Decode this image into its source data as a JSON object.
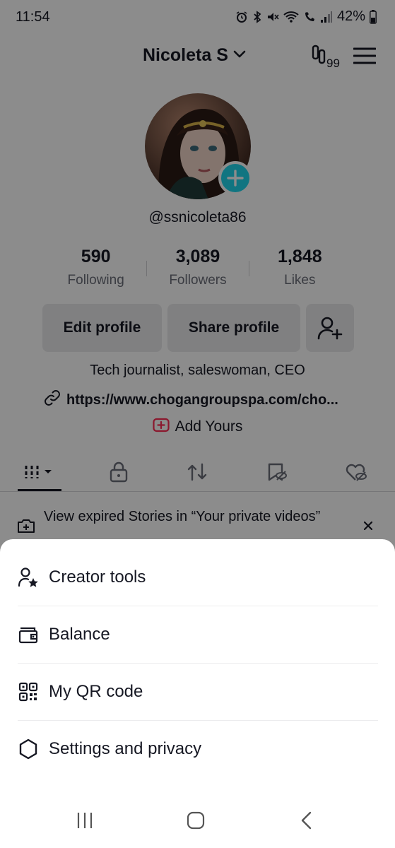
{
  "status_bar": {
    "time": "11:54",
    "battery": "42%",
    "icons": [
      "alarm-icon",
      "bluetooth-icon",
      "mute-icon",
      "wifi-icon",
      "wifi-calling-icon",
      "signal-icon",
      "battery-icon"
    ]
  },
  "header": {
    "display_name": "Nicoleta S",
    "badge_count": "99"
  },
  "profile": {
    "handle": "@ssnicoleta86",
    "stats": [
      {
        "value": "590",
        "label": "Following"
      },
      {
        "value": "3,089",
        "label": "Followers"
      },
      {
        "value": "1,848",
        "label": "Likes"
      }
    ],
    "edit_label": "Edit profile",
    "share_label": "Share profile",
    "bio": "Tech journalist, saleswoman, CEO",
    "link": "https://www.chogangroupspa.com/cho...",
    "add_yours": "Add Yours"
  },
  "tabs": [
    {
      "name": "videos",
      "icon": "grid-icon"
    },
    {
      "name": "private",
      "icon": "lock-icon"
    },
    {
      "name": "reposts",
      "icon": "repost-icon"
    },
    {
      "name": "favorites",
      "icon": "bookmark-hidden-icon"
    },
    {
      "name": "liked",
      "icon": "heart-hidden-icon"
    }
  ],
  "banner": {
    "text": "View expired Stories in “Your private videos”"
  },
  "sheet": {
    "items": [
      {
        "label": "Creator tools",
        "icon": "creator-star-icon"
      },
      {
        "label": "Balance",
        "icon": "wallet-icon"
      },
      {
        "label": "My QR code",
        "icon": "qr-code-icon"
      },
      {
        "label": "Settings and privacy",
        "icon": "gear-icon"
      }
    ]
  },
  "colors": {
    "accent": "#20d5ec",
    "add_yours_red": "#fe2c55",
    "text": "#161823",
    "secondary_text": "#6b6d78",
    "button_bg": "#eaeaec",
    "overlay": "rgba(0,0,0,0.45)"
  }
}
